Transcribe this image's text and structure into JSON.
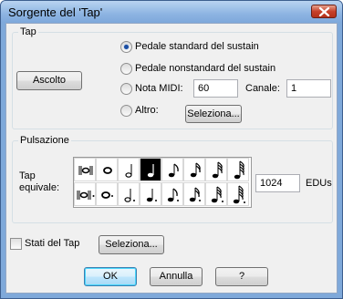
{
  "window": {
    "title": "Sorgente del 'Tap'"
  },
  "tap_group": {
    "label": "Tap",
    "listen_button": "Ascolto",
    "options": [
      {
        "label": "Pedale standard del sustain",
        "selected": true
      },
      {
        "label": "Pedale nonstandard del sustain",
        "selected": false
      },
      {
        "label": "Nota MIDI:",
        "selected": false
      },
      {
        "label": "Altro:",
        "selected": false
      }
    ],
    "midi_note": "60",
    "channel_label": "Canale:",
    "channel_value": "1",
    "select_button": "Seleziona..."
  },
  "pulse_group": {
    "label": "Pulsazione",
    "tap_equiv_label": "Tap\nequivale:",
    "edus_value": "1024",
    "edus_label": "EDUs",
    "durations_row1": [
      "breve",
      "whole",
      "half",
      "quarter",
      "eighth",
      "16th",
      "32nd",
      "64th"
    ],
    "durations_row2": [
      "dotted-breve",
      "dotted-whole",
      "dotted-half",
      "dotted-quarter",
      "dotted-eighth",
      "dotted-16th",
      "dotted-32nd",
      "dotted-64th"
    ],
    "selected_duration": "quarter"
  },
  "tap_states": {
    "label": "Stati del Tap",
    "checked": false,
    "select_button": "Seleziona..."
  },
  "footer": {
    "ok": "OK",
    "cancel": "Annulla",
    "help": "?"
  }
}
